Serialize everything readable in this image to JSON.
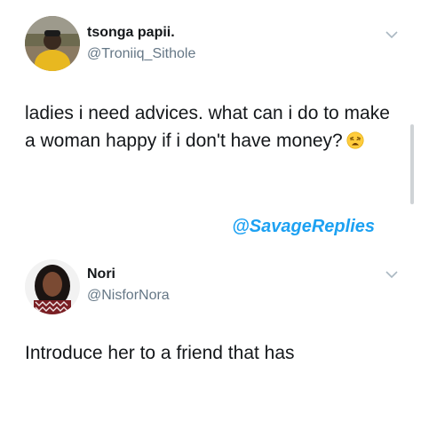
{
  "tweets": [
    {
      "display_name": "tsonga papii.",
      "handle": "@Troniiq_Sithole",
      "text": "ladies i need advices. what can i do to make a woman happy if i don't have money?",
      "emoji": "weary-face-emoji",
      "menu_icon": "chevron-down-icon"
    },
    {
      "display_name": "Nori",
      "handle": "@NisforNora",
      "text": "Introduce her to a friend that has",
      "menu_icon": "chevron-down-icon"
    }
  ],
  "watermark": "@SavageReplies",
  "colors": {
    "accent": "#1da1f2",
    "text": "#14171a",
    "secondary": "#657786"
  }
}
